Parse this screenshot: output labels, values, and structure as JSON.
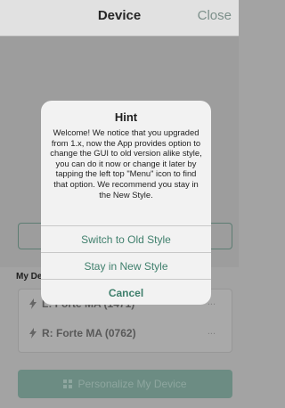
{
  "header": {
    "title": "Device",
    "close_label": "Close"
  },
  "my_devices_label": "My De",
  "devices": [
    {
      "name": "L: Forte MA (1471)",
      "more": "..."
    },
    {
      "name": "R: Forte MA (0762)",
      "more": "..."
    }
  ],
  "personalize_label": "Personalize My Device",
  "dialog": {
    "title": "Hint",
    "message": "Welcome! We notice that you upgraded from 1.x, now the App provides option to change the GUI to old version alike style, you can do it now or change it later by tapping the left top \"Menu\" icon to find that option. We recommend you stay in the New Style.",
    "buttons": [
      "Switch to Old Style",
      "Stay in New Style",
      "Cancel"
    ]
  }
}
